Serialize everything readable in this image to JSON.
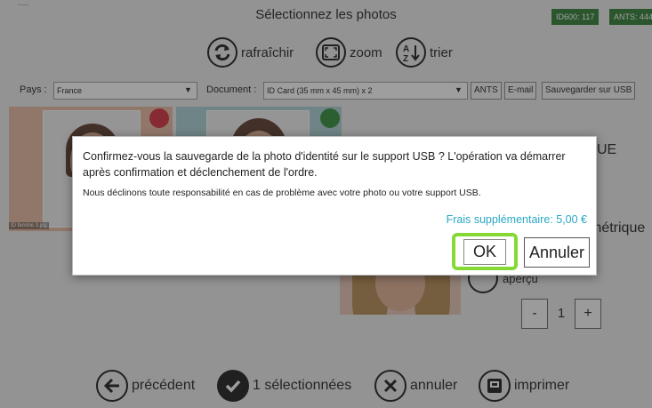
{
  "header": {
    "title": "Sélectionnez les photos",
    "corner_mark": "~~~",
    "badge_1": "ID600: 117",
    "badge_2": "ANTS: 444"
  },
  "toolbar": {
    "refresh_label": "rafraîchir",
    "zoom_label": "zoom",
    "sort_label": "trier"
  },
  "selectors": {
    "country_label": "Pays :",
    "country_value": "France",
    "document_label": "Document :",
    "document_value": "ID Card (35 mm x 45 mm) x 2",
    "ants_button": "ANTS",
    "email_button": "E-mail",
    "usb_button": "Sauvegarder sur USB"
  },
  "photos": [
    {
      "caption": "ID femme 3.jpg",
      "status_color": "#d32f3a"
    },
    {
      "caption": "",
      "status_color": "#2e8b3a"
    }
  ],
  "right_panel": {
    "heading_fragment": "UE",
    "subtitle_fragment": "métrique",
    "preview_label": "aperçu",
    "quantity": "1",
    "minus_label": "-",
    "plus_label": "+"
  },
  "bottom_bar": {
    "previous_label": "précédent",
    "selected_label": "1 sélectionnées",
    "cancel_label": "annuler",
    "print_label": "imprimer"
  },
  "dialog": {
    "message": "Confirmez-vous la sauvegarde de la photo d'identité sur le support USB ? L'opération va démarrer après confirmation et déclenchement de l'ordre.",
    "disclaimer": "Nous déclinons toute responsabilité en cas de problème avec votre photo ou votre support USB.",
    "fee": "Frais supplémentaire: 5,00 €",
    "ok_label": "OK",
    "cancel_label": "Annuler"
  },
  "colors": {
    "badge_bg": "#2e7d32",
    "fee_text": "#2aa7c4",
    "ok_highlight": "#84d934"
  }
}
